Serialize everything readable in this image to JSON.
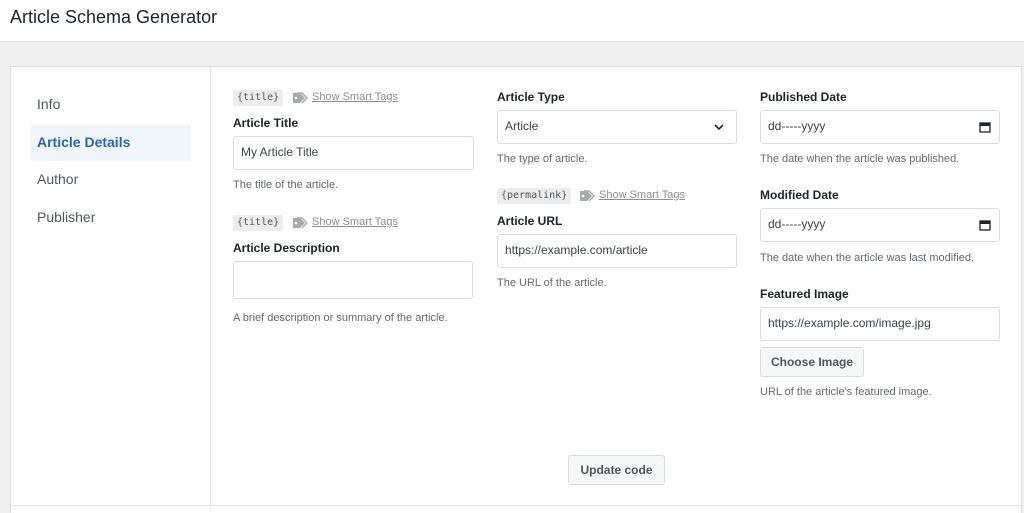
{
  "header": {
    "title": "Article Schema Generator"
  },
  "sidebar": {
    "items": [
      {
        "label": "Info"
      },
      {
        "label": "Article Details"
      },
      {
        "label": "Author"
      },
      {
        "label": "Publisher"
      }
    ],
    "active": "Article Details"
  },
  "smart_tags": {
    "link_label": "Show Smart Tags"
  },
  "fields": {
    "title": {
      "tag": "{title}",
      "label": "Article Title",
      "value": "My Article Title",
      "help": "The title of the article."
    },
    "description": {
      "tag": "{title}",
      "label": "Article Description",
      "value": "",
      "help": "A brief description or summary of the article."
    },
    "type": {
      "label": "Article Type",
      "value": "Article",
      "help": "The type of article."
    },
    "url": {
      "tag": "{permalink}",
      "label": "Article URL",
      "value": "https://example.com/article",
      "help": "The URL of the article."
    },
    "published": {
      "label": "Published Date",
      "value": "dd-----yyyy",
      "help": "The date when the article was published."
    },
    "modified": {
      "label": "Modified Date",
      "value": "dd-----yyyy",
      "help": "The date when the article was last modified."
    },
    "image": {
      "label": "Featured Image",
      "value": "https://example.com/image.jpg",
      "button": "Choose Image",
      "help": "URL of the article's featured image."
    }
  },
  "actions": {
    "update_label": "Update code"
  },
  "colors": {
    "accent": "#2c64b3",
    "active_bg": "#f0f6fc",
    "border": "#dcdcde",
    "page_bg": "#f0f0f1"
  },
  "icons": {
    "tag": "tag-icon",
    "select": "chevron-down-icon",
    "date": "calendar-icon"
  }
}
